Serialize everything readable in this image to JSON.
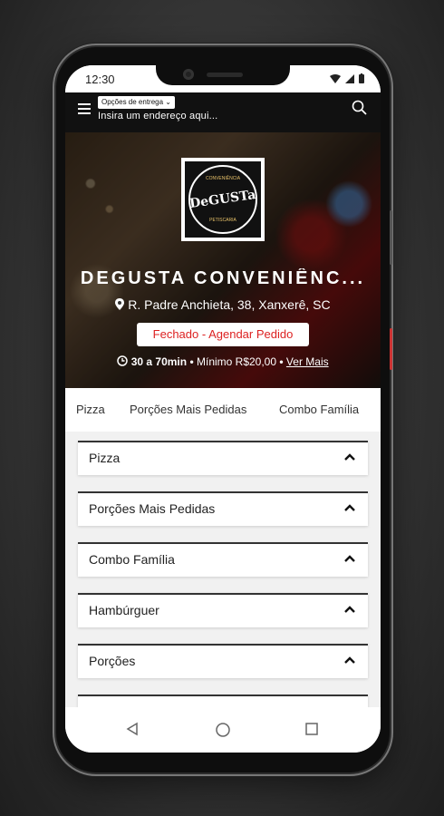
{
  "status_bar": {
    "time": "12:30"
  },
  "app_bar": {
    "delivery_options_label": "Opções de entrega",
    "address_placeholder": "Insira um endereço aqui..."
  },
  "store": {
    "logo_text_top": "CONVENIÊNCIA",
    "logo_text_main": "DeGUSTa",
    "logo_text_bottom": "PETISCARIA",
    "name": "DEGUSTA CONVENIÊNC...",
    "address": "R. Padre Anchieta, 38, Xanxerê, SC",
    "status": "Fechado - Agendar Pedido",
    "delivery_time": "30 a 70min",
    "minimum": "Mínimo R$20,00",
    "see_more": "Ver Mais"
  },
  "category_tabs": [
    {
      "label": "Pizza"
    },
    {
      "label": "Porções Mais Pedidas"
    },
    {
      "label": "Combo Família"
    }
  ],
  "sections": [
    {
      "label": "Pizza"
    },
    {
      "label": "Porções Mais Pedidas"
    },
    {
      "label": "Combo Família"
    },
    {
      "label": "Hambúrguer"
    },
    {
      "label": "Porções"
    }
  ]
}
